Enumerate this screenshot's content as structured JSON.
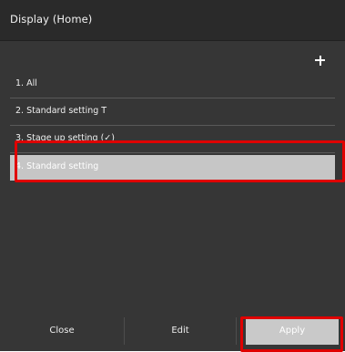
{
  "dialog": {
    "title": "Display (Home)"
  },
  "toolbar": {
    "add_label": "+"
  },
  "settings": {
    "items": [
      {
        "label": "1. All",
        "selected": false
      },
      {
        "label": "2. Standard setting T",
        "selected": false
      },
      {
        "label": "3. Stage up setting (✓)",
        "selected": false
      },
      {
        "label": "4. Standard setting",
        "selected": true
      }
    ]
  },
  "footer": {
    "close_label": "Close",
    "edit_label": "Edit",
    "apply_label": "Apply"
  },
  "colors": {
    "background": "#363636",
    "title_bar": "#2a2a2a",
    "selected_row": "#c6c6c6",
    "highlight": "#e00000"
  }
}
